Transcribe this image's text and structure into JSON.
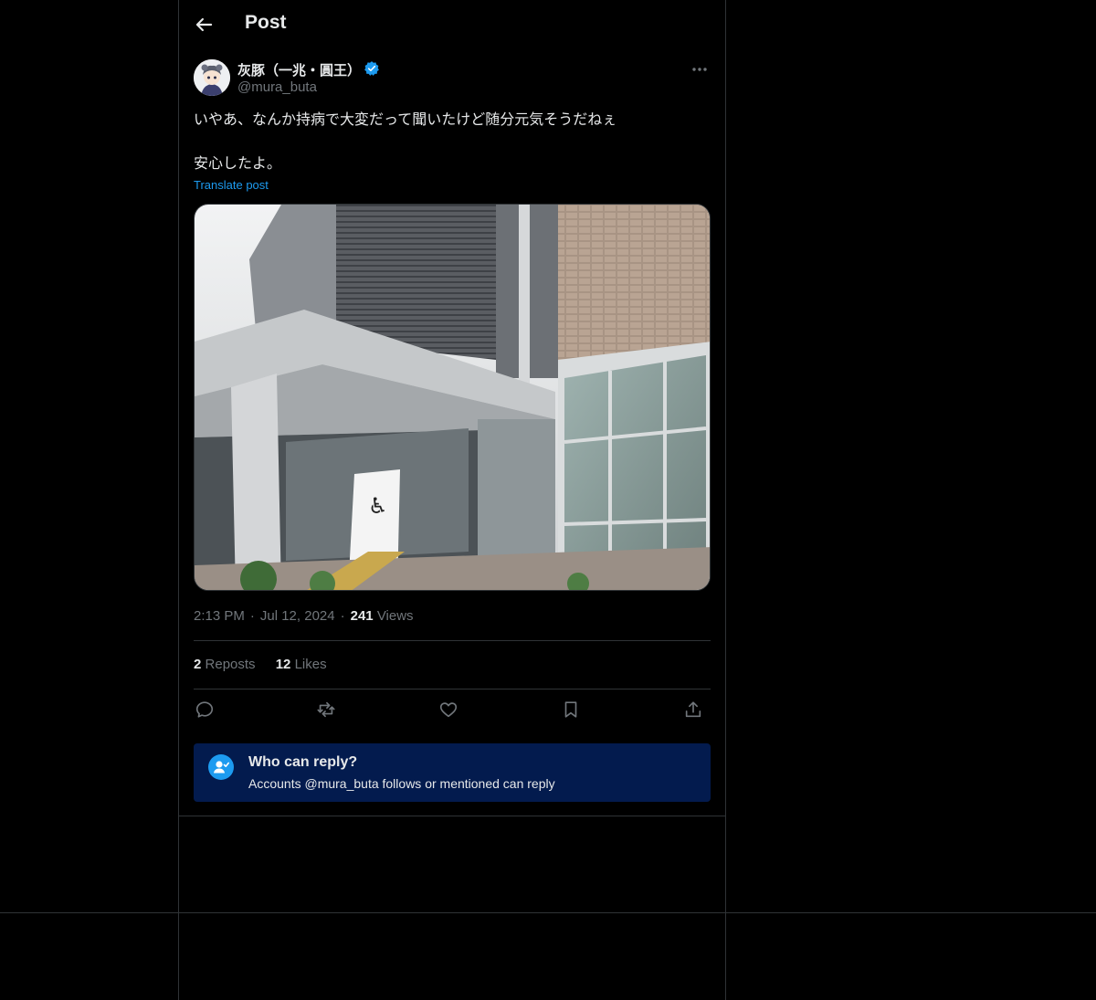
{
  "header": {
    "title": "Post"
  },
  "author": {
    "display_name": "灰豚（一兆・圓王）",
    "handle": "@mura_buta"
  },
  "post": {
    "text_lines": [
      "いやあ、なんか持病で大変だって聞いたけど随分元気そうだねぇ",
      "安心したよ。"
    ],
    "translate_label": "Translate post"
  },
  "meta": {
    "time": "2:13 PM",
    "date": "Jul 12, 2024",
    "views_count": "241",
    "views_label": "Views"
  },
  "stats": {
    "reposts_count": "2",
    "reposts_label": "Reposts",
    "likes_count": "12",
    "likes_label": "Likes"
  },
  "reply_settings": {
    "title": "Who can reply?",
    "subtitle": "Accounts @mura_buta follows or mentioned can reply"
  },
  "colors": {
    "background": "#000000",
    "accent": "#1d9bf0",
    "muted_text": "#71767b",
    "border": "#2f3336",
    "reply_box": "#031b4e"
  },
  "icons": [
    "back-arrow-icon",
    "verified-badge-icon",
    "more-options-icon",
    "reply-icon",
    "repost-icon",
    "like-icon",
    "bookmark-icon",
    "share-icon",
    "user-check-icon"
  ]
}
